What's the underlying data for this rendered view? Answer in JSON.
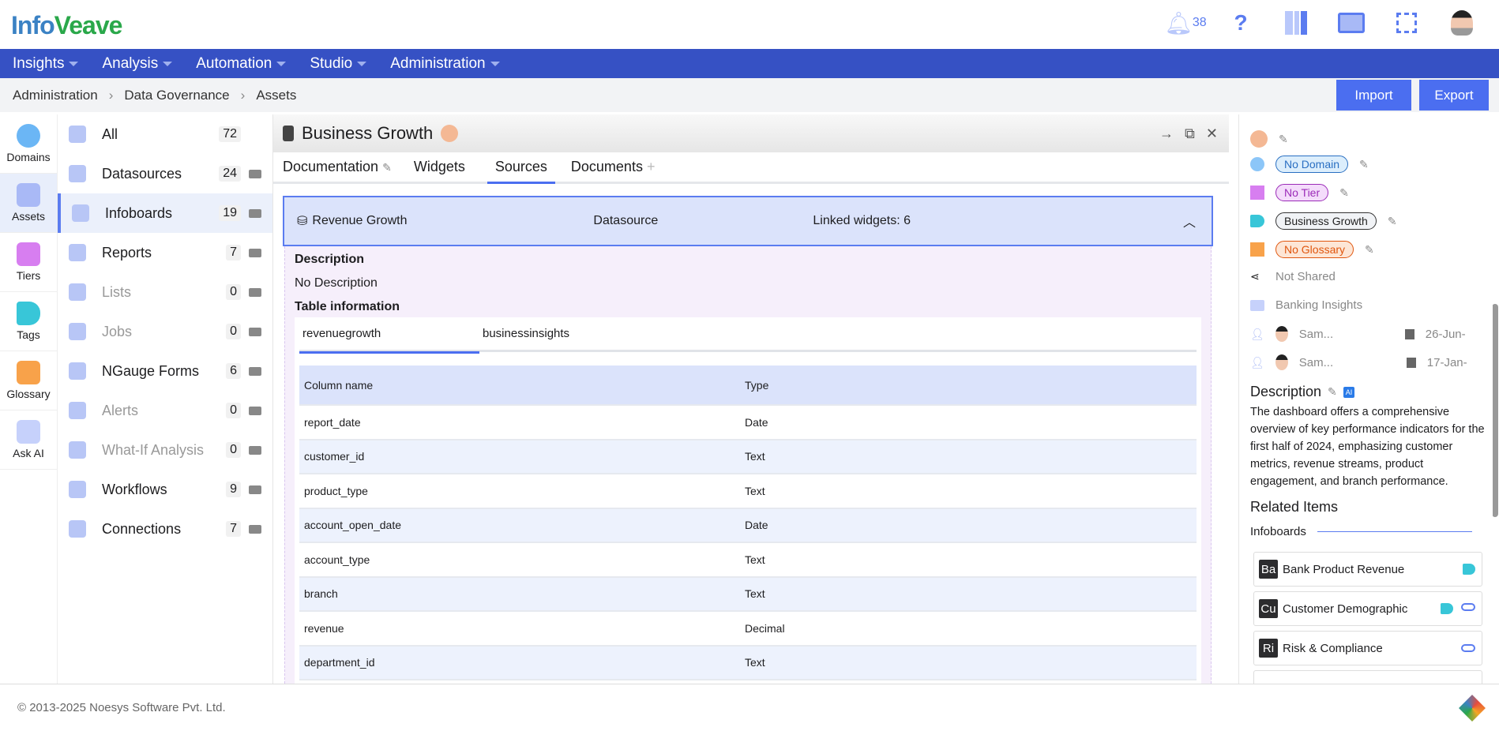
{
  "header": {
    "logo_text": "InfoVeave",
    "notifications_count": "38",
    "accent": "#3651c4",
    "button_color": "#4b6ef0"
  },
  "nav": [
    "Insights",
    "Analysis",
    "Automation",
    "Studio",
    "Administration"
  ],
  "breadcrumb": [
    "Administration",
    "Data Governance",
    "Assets"
  ],
  "actions": {
    "import": "Import",
    "export": "Export"
  },
  "rail": [
    {
      "label": "Domains",
      "icon": "globe-icon"
    },
    {
      "label": "Assets",
      "icon": "books-icon"
    },
    {
      "label": "Tiers",
      "icon": "layers-icon"
    },
    {
      "label": "Tags",
      "icon": "tag-icon"
    },
    {
      "label": "Glossary",
      "icon": "book-icon"
    },
    {
      "label": "Ask AI",
      "icon": "chat-icon"
    }
  ],
  "assets": [
    {
      "label": "All",
      "count": "72"
    },
    {
      "label": "Datasources",
      "count": "24"
    },
    {
      "label": "Infoboards",
      "count": "19"
    },
    {
      "label": "Reports",
      "count": "7"
    },
    {
      "label": "Lists",
      "count": "0"
    },
    {
      "label": "Jobs",
      "count": "0"
    },
    {
      "label": "NGauge Forms",
      "count": "6"
    },
    {
      "label": "Alerts",
      "count": "0"
    },
    {
      "label": "What-If Analysis",
      "count": "0"
    },
    {
      "label": "Workflows",
      "count": "9"
    },
    {
      "label": "Connections",
      "count": "7"
    }
  ],
  "detail": {
    "title": "Business Growth",
    "tabs": [
      "Documentation",
      "Widgets",
      "Sources",
      "Documents"
    ],
    "source": {
      "name": "Revenue Growth",
      "type": "Datasource",
      "linked": "Linked widgets: 6"
    },
    "description_label": "Description",
    "description": "No Description",
    "table_info_label": "Table information",
    "inner_tabs": [
      "revenuegrowth",
      "businessinsights"
    ],
    "columns": [
      "Column name",
      "Type"
    ],
    "rows": [
      [
        "report_date",
        "Date"
      ],
      [
        "customer_id",
        "Text"
      ],
      [
        "product_type",
        "Text"
      ],
      [
        "account_open_date",
        "Date"
      ],
      [
        "account_type",
        "Text"
      ],
      [
        "branch",
        "Text"
      ],
      [
        "revenue",
        "Decimal"
      ],
      [
        "department_id",
        "Text"
      ]
    ]
  },
  "right": {
    "domain": "No Domain",
    "tier": "No Tier",
    "tag": "Business Growth",
    "glossary": "No Glossary",
    "shared": "Not Shared",
    "folder": "Banking Insights",
    "created_by": "Sam...",
    "created_date": "26-Jun-",
    "modified_by": "Sam...",
    "modified_date": "17-Jan-",
    "description_label": "Description",
    "ai_label": "AI",
    "description": "The dashboard offers a comprehensive overview of key performance indicators for the first half of 2024, emphasizing customer metrics, revenue streams, product engagement, and branch performance.",
    "related_label": "Related Items",
    "related_section": "Infoboards",
    "related": [
      {
        "abbr": "Ba",
        "name": "Bank Product Revenue"
      },
      {
        "abbr": "Cu",
        "name": "Customer Demographic"
      },
      {
        "abbr": "Ri",
        "name": "Risk & Compliance"
      }
    ]
  },
  "footer": {
    "copyright": "© 2013-2025 Noesys Software Pvt. Ltd."
  }
}
